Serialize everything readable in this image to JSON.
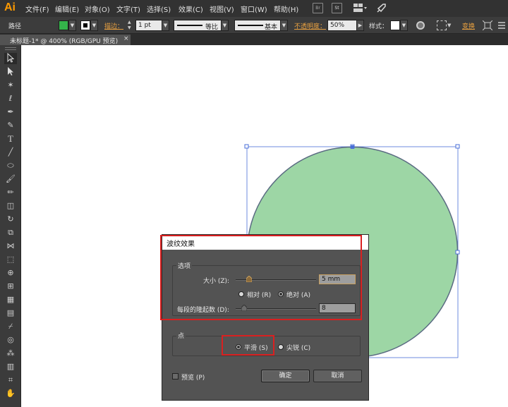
{
  "app": {
    "logo": "Ai"
  },
  "menu": [
    "文件(F)",
    "编辑(E)",
    "对象(O)",
    "文字(T)",
    "选择(S)",
    "效果(C)",
    "视图(V)",
    "窗口(W)",
    "帮助(H)"
  ],
  "menubar_icons": {
    "br": "Br",
    "st": "St"
  },
  "control": {
    "object_type": "路径",
    "fill_color": "#34b34a",
    "stroke_label": "描边：",
    "stroke_weight": "1 pt",
    "profile_label": "等比",
    "brush_label": "基本",
    "opacity_label": "不透明度：",
    "opacity_value": "50%",
    "style_label": "样式：",
    "transform_label": "变换"
  },
  "tab": {
    "title": "未标题-1* @ 400% (RGB/GPU 预览)",
    "close": "×"
  },
  "canvas": {
    "circle_fill": "#9dd6a5",
    "circle_stroke": "#5a6b82",
    "selection_color": "#4a6fd8"
  },
  "dialog": {
    "title": "波纹效果",
    "options_group": "选项",
    "size_label": "大小 (Z):",
    "size_value": "5 mm",
    "relative_label": "相对 (R)",
    "absolute_label": "绝对 (A)",
    "ridges_label": "每段的隆起数 (D):",
    "ridges_value": "8",
    "points_group": "点",
    "smooth_label": "平滑 (S)",
    "corner_label": "尖锐 (C)",
    "preview_label": "预览 (P)",
    "ok_label": "确定",
    "cancel_label": "取消"
  }
}
